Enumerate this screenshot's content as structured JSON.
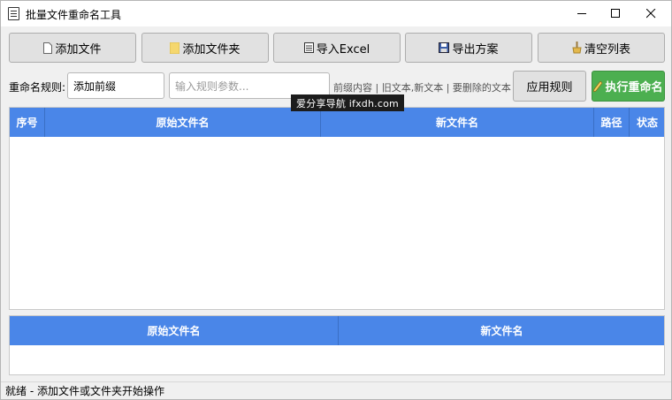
{
  "window": {
    "title": "批量文件重命名工具"
  },
  "toolbar": {
    "add_files": "添加文件",
    "add_folder": "添加文件夹",
    "import_excel": "导入Excel",
    "export_plan": "导出方案",
    "clear_list": "清空列表"
  },
  "rule_bar": {
    "label": "重命名规则:",
    "rule_value": "添加前缀",
    "param_placeholder": "输入规则参数...",
    "hint": "前缀内容 | 旧文本,新文本 | 要删除的文本",
    "apply_button": "应用规则",
    "execute_button": "执行重命名"
  },
  "file_table": {
    "columns": [
      "序号",
      "原始文件名",
      "新文件名",
      "路径",
      "状态"
    ],
    "rows": []
  },
  "preview_table": {
    "columns": [
      "原始文件名",
      "新文件名"
    ],
    "rows": []
  },
  "watermark": "爱分享导航 ifxdh.com",
  "status": "就绪 - 添加文件或文件夹开始操作",
  "colors": {
    "header_blue": "#4a86e8",
    "execute_green": "#4caf50",
    "folder_yellow": "#f5d76e"
  }
}
